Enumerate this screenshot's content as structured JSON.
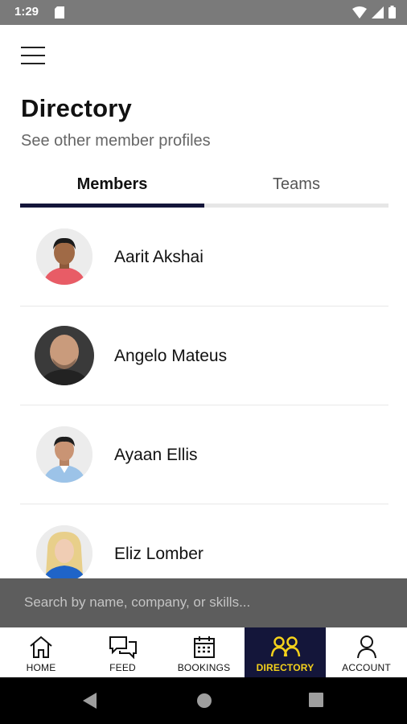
{
  "status": {
    "time": "1:29"
  },
  "header": {
    "title": "Directory",
    "subtitle": "See other member profiles"
  },
  "tabs": [
    {
      "label": "Members",
      "active": true
    },
    {
      "label": "Teams",
      "active": false
    }
  ],
  "members": [
    {
      "name": "Aarit Akshai"
    },
    {
      "name": "Angelo Mateus"
    },
    {
      "name": "Ayaan Ellis"
    },
    {
      "name": "Eliz Lomber"
    }
  ],
  "search": {
    "placeholder": "Search by name, company, or skills..."
  },
  "bottom_nav": [
    {
      "label": "HOME",
      "icon": "home-icon",
      "active": false
    },
    {
      "label": "FEED",
      "icon": "chat-bubbles-icon",
      "active": false
    },
    {
      "label": "BOOKINGS",
      "icon": "calendar-icon",
      "active": false
    },
    {
      "label": "DIRECTORY",
      "icon": "people-icon",
      "active": true
    },
    {
      "label": "ACCOUNT",
      "icon": "person-icon",
      "active": false
    }
  ],
  "colors": {
    "accent_dark": "#14163a",
    "accent_yellow": "#f5d21b",
    "search_bg": "#5d5d5d",
    "status_bar": "#7a7a7a"
  }
}
